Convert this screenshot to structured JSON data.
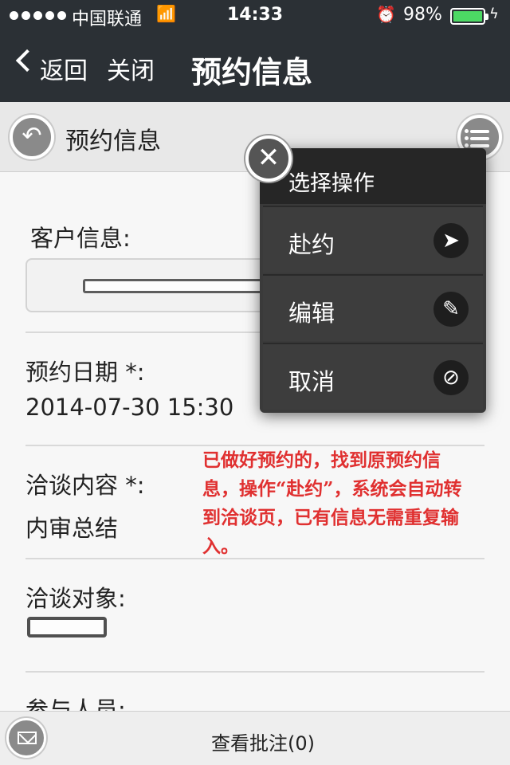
{
  "status_bar": {
    "carrier": "中国联通",
    "time": "14:33",
    "battery_percent": "98%"
  },
  "nav": {
    "back_label": "返回",
    "close_label": "关闭",
    "title": "预约信息"
  },
  "sub_header": {
    "title": "预约信息"
  },
  "form": {
    "client_info_label": "客户信息:",
    "date_label": "预约日期 *:",
    "date_value": "2014-07-30 15:30",
    "content_label": "洽谈内容 *:",
    "content_value": "内审总结",
    "target_label": "洽谈对象:",
    "participants_label": "参与人员:"
  },
  "annotation": "已做好预约的，找到原预约信息，操作“赴约”，系统会自动转到洽谈页，已有信息无需重复输入。",
  "popup_menu": {
    "title": "选择操作",
    "items": [
      {
        "label": "赴约",
        "icon": "navigate-arrow-icon"
      },
      {
        "label": "编辑",
        "icon": "pencil-icon"
      },
      {
        "label": "取消",
        "icon": "prohibited-icon"
      }
    ]
  },
  "bottom_bar": {
    "view_notes_label": "查看批注(0)"
  },
  "colors": {
    "nav_background": "#2b3035",
    "annotation_red": "#e03030",
    "battery_green": "#4cd964"
  }
}
